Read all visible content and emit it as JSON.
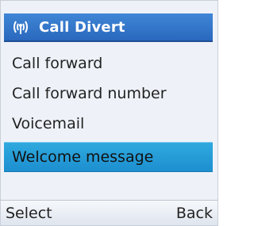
{
  "header": {
    "title": "Call Divert",
    "icon": "antenna-signal-icon"
  },
  "menu": {
    "items": [
      {
        "label": "Call forward",
        "selected": false
      },
      {
        "label": "Call forward number",
        "selected": false
      },
      {
        "label": "Voicemail",
        "selected": false
      },
      {
        "label": "Welcome message",
        "selected": true
      }
    ]
  },
  "softkeys": {
    "left": "Select",
    "right": "Back"
  },
  "colors": {
    "title_bar": "#2f74c8",
    "selected_item": "#1f97d6",
    "background": "#eef2f8"
  }
}
